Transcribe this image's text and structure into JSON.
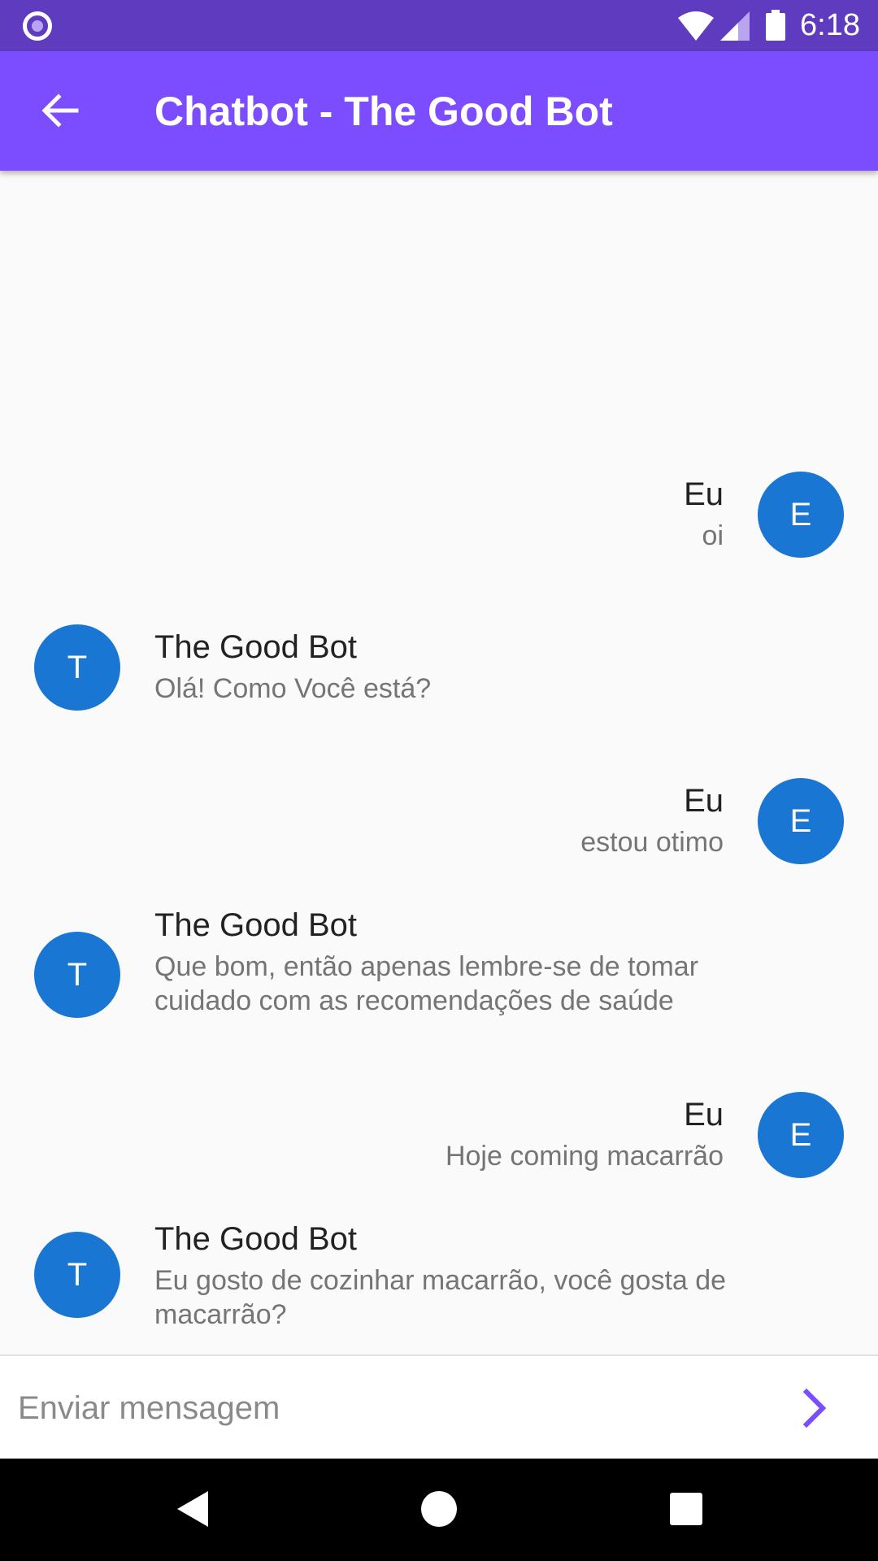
{
  "status_bar": {
    "time": "6:18",
    "icons": [
      "notification-icon",
      "wifi-icon",
      "signal-icon",
      "battery-icon"
    ]
  },
  "app_bar": {
    "title": "Chatbot - The Good Bot",
    "back_icon": "arrow-back-icon"
  },
  "colors": {
    "status_bar": "#5e3bbf",
    "app_bar": "#7c4dff",
    "avatar": "#1976d2",
    "send_icon": "#7c4dff",
    "background": "#fafafa"
  },
  "messages": [
    {
      "role": "user",
      "avatar_initial": "E",
      "sender": "Eu",
      "text": "oi"
    },
    {
      "role": "bot",
      "avatar_initial": "T",
      "sender": "The Good Bot",
      "text": "Olá! Como Você está?"
    },
    {
      "role": "user",
      "avatar_initial": "E",
      "sender": "Eu",
      "text": "estou otimo"
    },
    {
      "role": "bot",
      "avatar_initial": "T",
      "sender": "The Good Bot",
      "text": "Que bom, então apenas lembre-se de tomar cuidado com as recomendações de saúde"
    },
    {
      "role": "user",
      "avatar_initial": "E",
      "sender": "Eu",
      "text": "Hoje coming macarrão"
    },
    {
      "role": "bot",
      "avatar_initial": "T",
      "sender": "The Good Bot",
      "text": "Eu gosto de cozinhar macarrão, você gosta de macarrão?"
    }
  ],
  "composer": {
    "placeholder": "Enviar mensagem",
    "value": "",
    "send_icon": "chevron-right-icon"
  },
  "nav_bar": {
    "icons": [
      "back-triangle-icon",
      "home-circle-icon",
      "recents-square-icon"
    ]
  }
}
